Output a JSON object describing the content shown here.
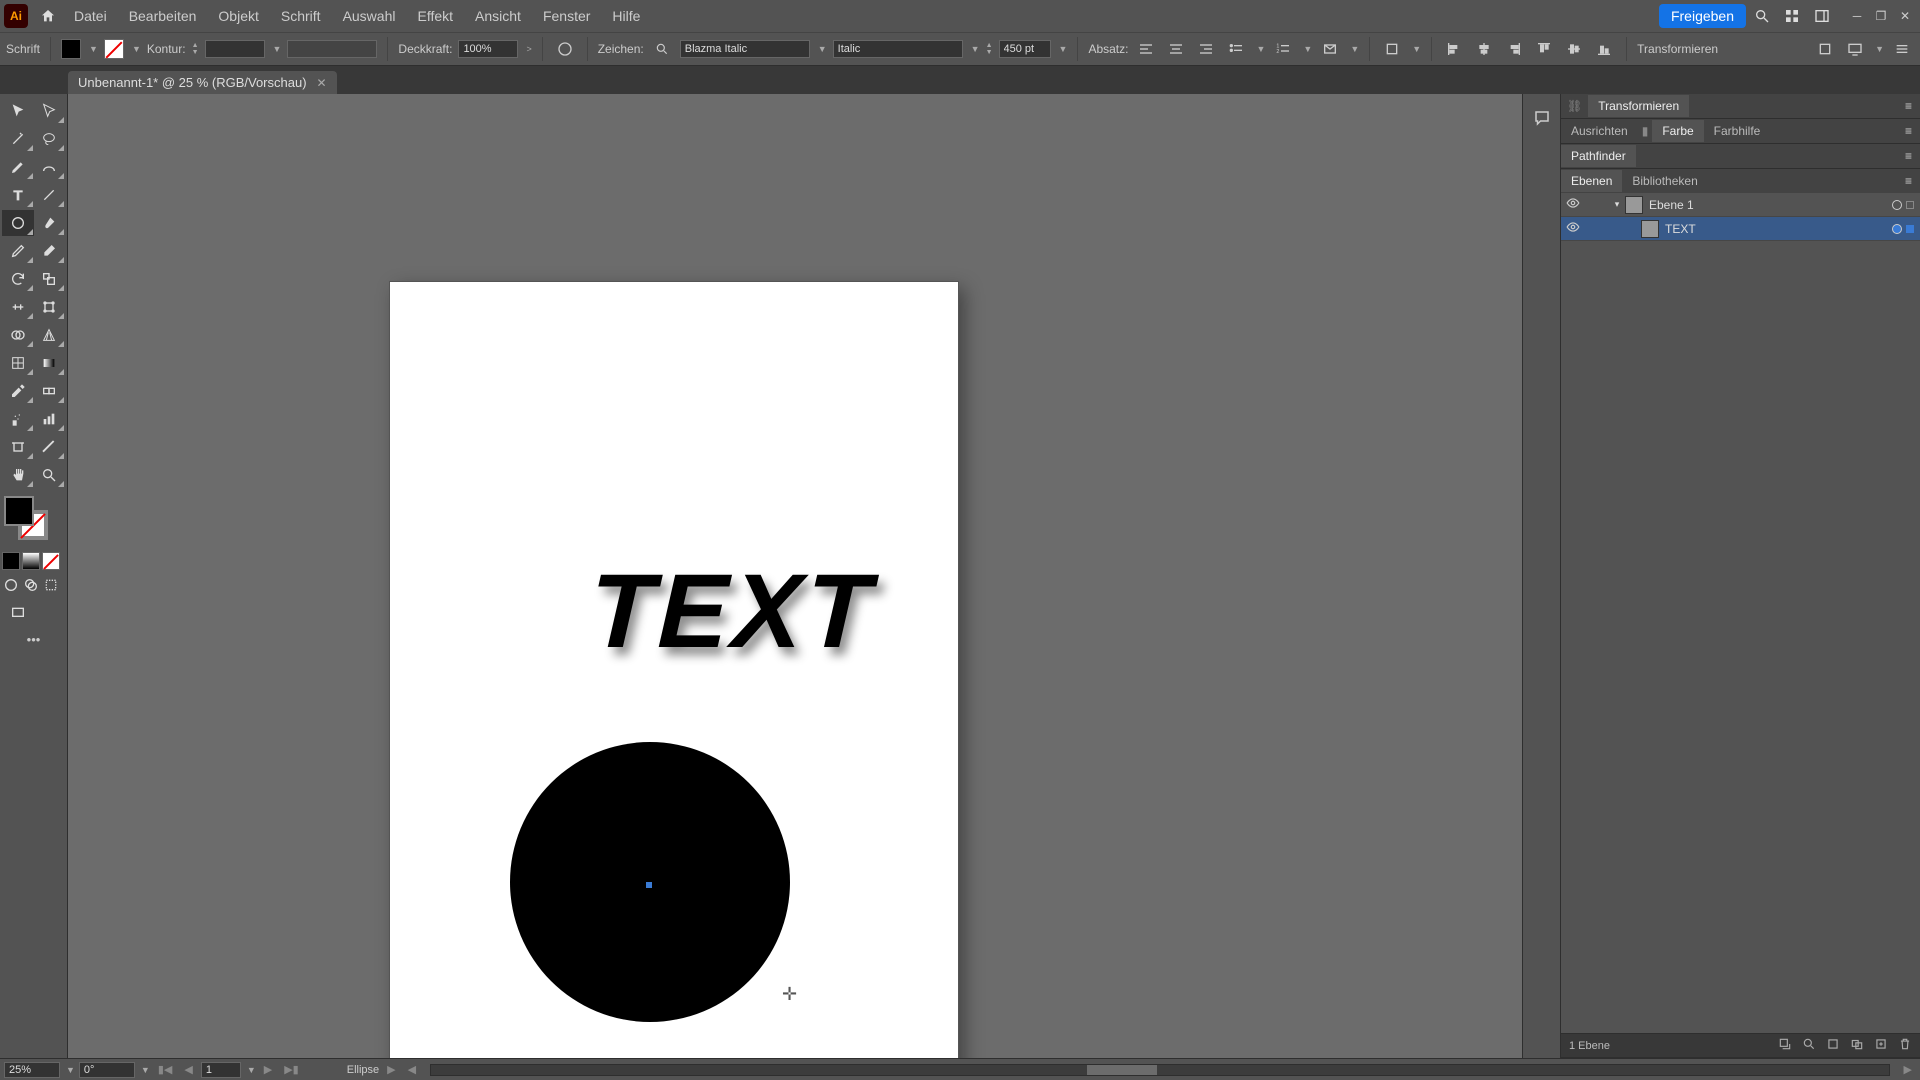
{
  "menubar": {
    "app_abbrev": "Ai",
    "items": [
      "Datei",
      "Bearbeiten",
      "Objekt",
      "Schrift",
      "Auswahl",
      "Effekt",
      "Ansicht",
      "Fenster",
      "Hilfe"
    ],
    "share_label": "Freigeben"
  },
  "optionbar": {
    "mode_label": "Schrift",
    "stroke_label": "Kontur:",
    "stroke_value": "",
    "opacity_label": "Deckkraft:",
    "opacity_value": "100%",
    "char_label": "Zeichen:",
    "font_name": "Blazma Italic",
    "font_style": "Italic",
    "font_size": "450 pt",
    "paragraph_label": "Absatz:",
    "transform_label": "Transformieren"
  },
  "document": {
    "tab_title": "Unbenannt-1* @ 25 % (RGB/Vorschau)",
    "artboard_text": "TEXT"
  },
  "panels": {
    "transform_tab": "Transformieren",
    "align_tab": "Ausrichten",
    "color_tab": "Farbe",
    "guides_tab": "Farbhilfe",
    "pathfinder_tab": "Pathfinder",
    "layers_tab": "Ebenen",
    "libraries_tab": "Bibliotheken",
    "layer1_name": "Ebene 1",
    "text_layer_name": "TEXT",
    "footer_count": "1 Ebene"
  },
  "statusbar": {
    "zoom": "25%",
    "rotation": "0°",
    "artboard_num": "1",
    "tool_name": "Ellipse"
  }
}
